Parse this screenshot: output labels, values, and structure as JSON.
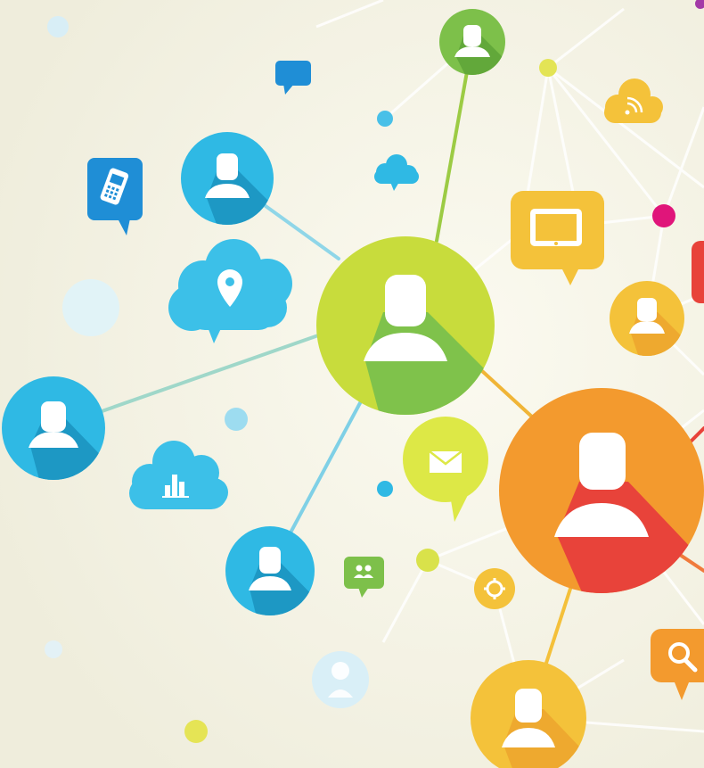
{
  "scene": {
    "subject": "social-network-illustration",
    "palette": {
      "background": "#f3f1e2",
      "cyan": "#2fb9e4",
      "cyan_light": "#6fd3ef",
      "green": "#7dc04a",
      "lime": "#c8dc3c",
      "yellow": "#f4cf3a",
      "orange": "#f39a2e",
      "red": "#e8433a",
      "magenta": "#e0157a",
      "blue": "#1f8ed6",
      "link": "#ffffff"
    },
    "nodes": [
      {
        "name": "person-node-green-top",
        "color": "green"
      },
      {
        "name": "person-node-cyan-upper-left",
        "color": "cyan"
      },
      {
        "name": "person-node-lime-center",
        "color": "lime"
      },
      {
        "name": "person-node-cyan-left",
        "color": "cyan"
      },
      {
        "name": "person-node-cyan-lower",
        "color": "cyan"
      },
      {
        "name": "person-node-yellow-right",
        "color": "yellow"
      },
      {
        "name": "person-node-orange-large",
        "color": "orange"
      },
      {
        "name": "person-node-yellow-bottom",
        "color": "yellow"
      }
    ],
    "icons": [
      "mobile-phone-icon",
      "chat-bubble-icon",
      "location-pin-icon",
      "cloud-icon",
      "bar-chart-cloud-icon",
      "rss-cloud-icon",
      "tablet-icon",
      "mail-icon",
      "gear-icon",
      "search-icon",
      "contacts-icon"
    ]
  }
}
